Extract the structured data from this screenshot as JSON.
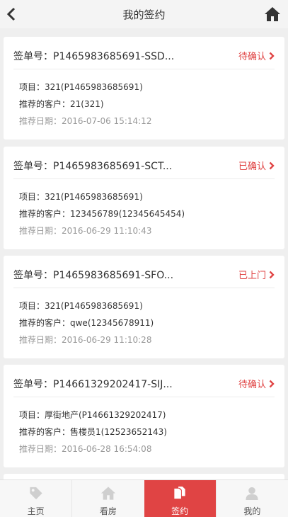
{
  "header": {
    "title": "我的签约"
  },
  "cards": [
    {
      "sign_no": "签单号：P1465983685691-SSD...",
      "status": "待确认",
      "project": "项目：321(P1465983685691)",
      "customer": "推荐的客户：21(321)",
      "date": "推荐日期：2016-07-06 15:14:12"
    },
    {
      "sign_no": "签单号：P1465983685691-SCT...",
      "status": "已确认",
      "project": "项目：321(P1465983685691)",
      "customer": "推荐的客户：123456789(12345645454)",
      "date": "推荐日期：2016-06-29 11:10:43"
    },
    {
      "sign_no": "签单号：P1465983685691-SFO...",
      "status": "已上门",
      "project": "项目：321(P1465983685691)",
      "customer": "推荐的客户：qwe(12345678911)",
      "date": "推荐日期：2016-06-29 11:10:28"
    },
    {
      "sign_no": "签单号：P14661329202417-SIJ...",
      "status": "待确认",
      "project": "项目：厚街地产(P14661329202417)",
      "customer": "推荐的客户：售楼员1(12523652143)",
      "date": "推荐日期：2016-06-28 16:54:08"
    }
  ],
  "tabbar": [
    {
      "label": "主页",
      "icon": "tag-icon"
    },
    {
      "label": "看房",
      "icon": "home-icon"
    },
    {
      "label": "签约",
      "icon": "documents-icon",
      "active": true
    },
    {
      "label": "我的",
      "icon": "user-icon"
    }
  ],
  "colors": {
    "accent": "#e04444",
    "background": "#efefef"
  }
}
